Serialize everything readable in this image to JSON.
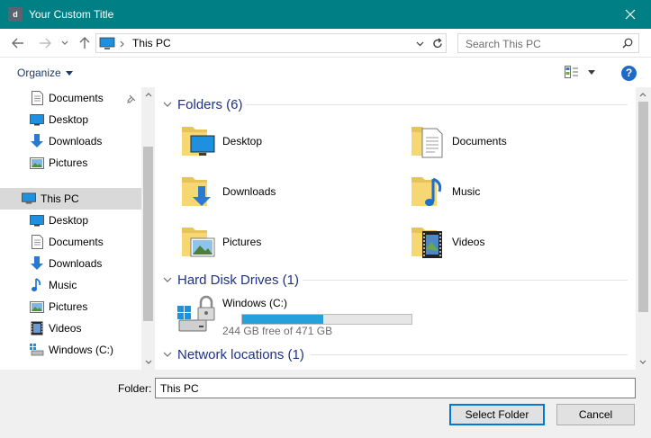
{
  "window": {
    "title": "Your Custom Title",
    "app_icon_letter": "d"
  },
  "address": {
    "path": "This PC",
    "search_placeholder": "Search This PC"
  },
  "toolbar": {
    "organize_label": "Organize"
  },
  "nav_pane": {
    "items": [
      {
        "label": "Documents",
        "icon": "documents-icon",
        "pinned": true
      },
      {
        "label": "Desktop",
        "icon": "desktop-icon"
      },
      {
        "label": "Downloads",
        "icon": "downloads-icon"
      },
      {
        "label": "Pictures",
        "icon": "pictures-icon"
      },
      {
        "label": "This PC",
        "icon": "this-pc-icon",
        "selected": true
      },
      {
        "label": "Desktop",
        "icon": "desktop-icon"
      },
      {
        "label": "Documents",
        "icon": "documents-icon"
      },
      {
        "label": "Downloads",
        "icon": "downloads-icon"
      },
      {
        "label": "Music",
        "icon": "music-icon"
      },
      {
        "label": "Pictures",
        "icon": "pictures-icon"
      },
      {
        "label": "Videos",
        "icon": "videos-icon"
      },
      {
        "label": "Windows (C:)",
        "icon": "drive-icon"
      }
    ]
  },
  "content": {
    "folders_header": "Folders (6)",
    "folders": [
      {
        "label": "Desktop",
        "icon": "desktop-folder-icon"
      },
      {
        "label": "Documents",
        "icon": "documents-folder-icon"
      },
      {
        "label": "Downloads",
        "icon": "downloads-folder-icon"
      },
      {
        "label": "Music",
        "icon": "music-folder-icon"
      },
      {
        "label": "Pictures",
        "icon": "pictures-folder-icon"
      },
      {
        "label": "Videos",
        "icon": "videos-folder-icon"
      }
    ],
    "drives_header": "Hard Disk Drives (1)",
    "drive": {
      "label": "Windows (C:)",
      "free_text": "244 GB free of 471 GB",
      "used_fraction": 0.48
    },
    "network_header": "Network locations (1)"
  },
  "footer": {
    "folder_label": "Folder:",
    "folder_value": "This PC",
    "select_label": "Select Folder",
    "cancel_label": "Cancel"
  },
  "colors": {
    "titlebar": "#007f84",
    "accent": "#0078d7",
    "header_text": "#1e3287",
    "progress": "#26a0da"
  }
}
